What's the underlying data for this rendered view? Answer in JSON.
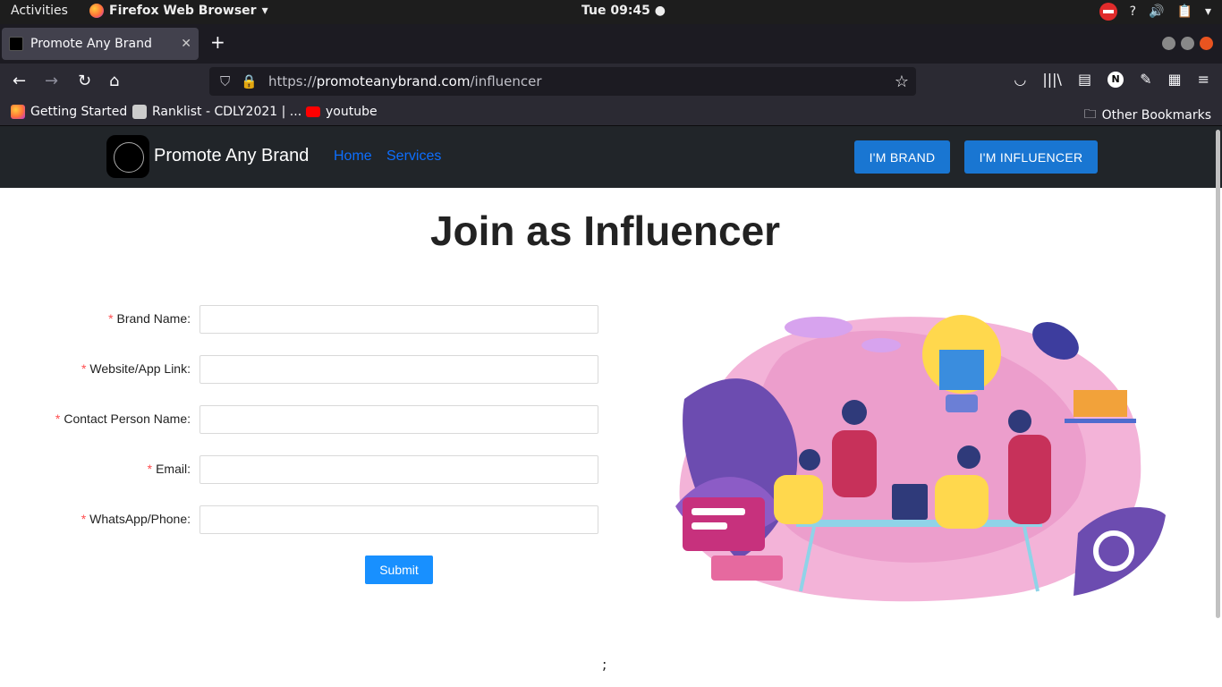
{
  "system": {
    "activities": "Activities",
    "app_name": "Firefox Web Browser",
    "clock": "Tue 09:45"
  },
  "browser": {
    "tab_title": "Promote Any Brand",
    "url_prefix": "https://",
    "url_host": "promoteanybrand.com",
    "url_path": "/influencer",
    "bookmarks": [
      "Getting Started",
      "Ranklist - CDLY2021 | ...",
      "youtube"
    ],
    "other_bookmarks": "Other Bookmarks"
  },
  "site": {
    "brand_name": "Promote Any Brand",
    "nav": [
      "Home",
      "Services"
    ],
    "brand_button": "I'M BRAND",
    "influencer_button": "I'M INFLUENCER"
  },
  "form": {
    "heading": "Join as Influencer",
    "fields": [
      {
        "label": "Brand Name",
        "value": ""
      },
      {
        "label": "Website/App Link",
        "value": ""
      },
      {
        "label": "Contact Person Name",
        "value": ""
      },
      {
        "label": "Email",
        "value": ""
      },
      {
        "label": "WhatsApp/Phone",
        "value": ""
      }
    ],
    "required_mark": "*",
    "label_suffix": ":",
    "submit": "Submit"
  },
  "footer_text": ";",
  "colors": {
    "header_bg": "#212529",
    "nav_link": "#0d6efd",
    "header_button": "#1976d2",
    "submit": "#1890ff",
    "required": "#ff4d4f"
  }
}
